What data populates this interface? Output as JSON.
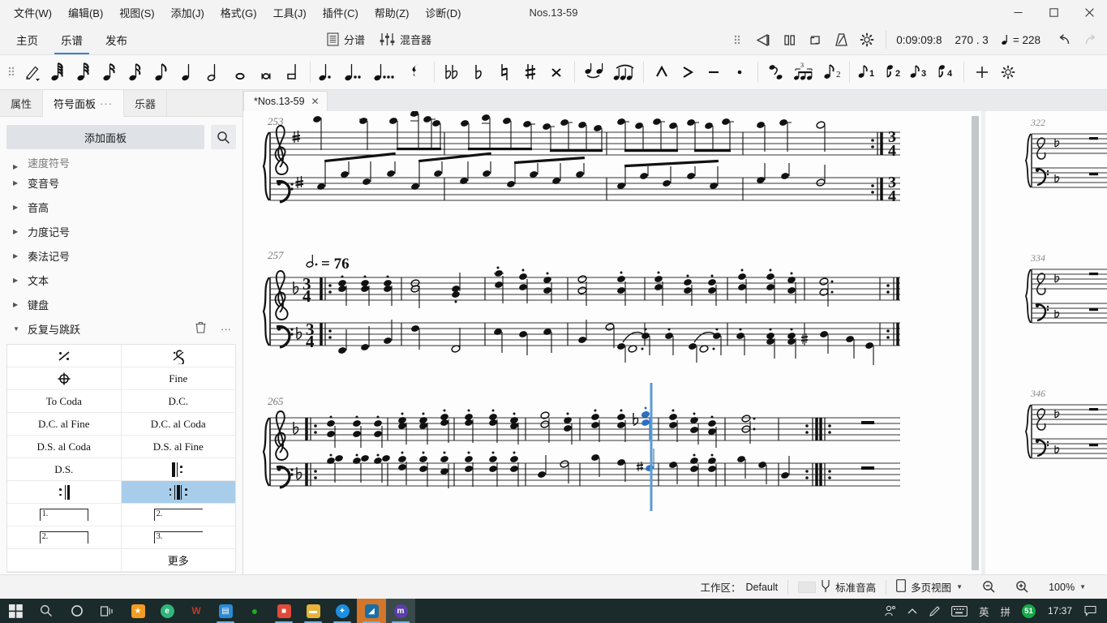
{
  "window": {
    "title": "Nos.13-59",
    "minimize": "–",
    "maximize": "☐",
    "close": "✕"
  },
  "menubar": [
    {
      "label": "文件(W)",
      "name": "menu-file"
    },
    {
      "label": "编辑(B)",
      "name": "menu-edit"
    },
    {
      "label": "视图(S)",
      "name": "menu-view"
    },
    {
      "label": "添加(J)",
      "name": "menu-add"
    },
    {
      "label": "格式(G)",
      "name": "menu-format"
    },
    {
      "label": "工具(J)",
      "name": "menu-tools"
    },
    {
      "label": "插件(C)",
      "name": "menu-plugins"
    },
    {
      "label": "帮助(Z)",
      "name": "menu-help"
    },
    {
      "label": "诊断(D)",
      "name": "menu-diagnostic"
    }
  ],
  "ribbon": {
    "tabs": [
      {
        "label": "主页",
        "active": false
      },
      {
        "label": "乐谱",
        "active": true
      },
      {
        "label": "发布",
        "active": false
      }
    ],
    "parts_label": "分谱",
    "mixer_label": "混音器",
    "timecode": "0:09:09:8",
    "position": "270 . 3",
    "tempo_value": "= 228",
    "tempo_note": "♩"
  },
  "notebar": {
    "durations": [
      "pencil",
      "128th",
      "64th",
      "32nd",
      "16th",
      "eighth",
      "quarter",
      "half",
      "whole",
      "breve",
      "longa"
    ],
    "dots": [
      "dotted",
      "double-dotted",
      "triple-dotted",
      "rest"
    ],
    "accidentals": [
      "double-flat",
      "flat",
      "natural",
      "sharp",
      "double-sharp"
    ],
    "ties": [
      "tie",
      "slur"
    ],
    "articulations": [
      "marcato",
      "accent",
      "tenuto",
      "staccato"
    ],
    "rhythm": [
      "flip-stem",
      "tuplet",
      "grace-note"
    ],
    "voices": [
      "1",
      "2",
      "3",
      "4"
    ],
    "plus": "+",
    "gear": "gear"
  },
  "leftpanel": {
    "tabs": [
      {
        "label": "属性",
        "name": "tab-properties",
        "active": false
      },
      {
        "label": "符号面板",
        "name": "tab-symbol-panel",
        "active": true,
        "dots": "···"
      },
      {
        "label": "乐器",
        "name": "tab-instruments",
        "active": false
      }
    ],
    "add_panel_label": "添加面板",
    "search_icon": "search-icon",
    "categories": [
      {
        "label": "速度符号",
        "expanded": false,
        "clipped": true
      },
      {
        "label": "变音号",
        "expanded": false
      },
      {
        "label": "音高",
        "expanded": false
      },
      {
        "label": "力度记号",
        "expanded": false
      },
      {
        "label": "奏法记号",
        "expanded": false
      },
      {
        "label": "文本",
        "expanded": false
      },
      {
        "label": "键盘",
        "expanded": false
      }
    ],
    "open_category": {
      "label": "反复与跳跃",
      "delete_icon": "trash-icon",
      "more_icon": "more-icon"
    },
    "symbols": [
      {
        "label": "⁓",
        "kind": "glyph",
        "name": "symbol-repeat-measure",
        "selected": false
      },
      {
        "label": "𝄌",
        "kind": "segno",
        "name": "symbol-segno",
        "selected": false
      },
      {
        "label": "⊕",
        "kind": "coda",
        "name": "symbol-coda",
        "selected": false
      },
      {
        "label": "Fine",
        "kind": "text",
        "name": "symbol-fine",
        "selected": false
      },
      {
        "label": "To Coda",
        "kind": "text",
        "name": "symbol-to-coda",
        "selected": false
      },
      {
        "label": "D.C.",
        "kind": "text",
        "name": "symbol-dc",
        "selected": false
      },
      {
        "label": "D.C. al Fine",
        "kind": "text",
        "name": "symbol-dc-al-fine",
        "selected": false
      },
      {
        "label": "D.C. al Coda",
        "kind": "text",
        "name": "symbol-dc-al-coda",
        "selected": false
      },
      {
        "label": "D.S. al Coda",
        "kind": "text",
        "name": "symbol-ds-al-coda",
        "selected": false
      },
      {
        "label": "D.S. al Fine",
        "kind": "text",
        "name": "symbol-ds-al-fine",
        "selected": false
      },
      {
        "label": "D.S.",
        "kind": "text",
        "name": "symbol-ds",
        "selected": false
      },
      {
        "label": "",
        "kind": "repeat-start",
        "name": "symbol-repeat-start",
        "selected": false
      },
      {
        "label": "",
        "kind": "repeat-end",
        "name": "symbol-repeat-end",
        "selected": false
      },
      {
        "label": "",
        "kind": "repeat-both",
        "name": "symbol-repeat-end-start",
        "selected": true
      },
      {
        "label": "1.",
        "kind": "volta",
        "name": "symbol-volta-1",
        "selected": false
      },
      {
        "label": "2.",
        "kind": "volta-open",
        "name": "symbol-volta-2-open",
        "selected": false
      },
      {
        "label": "2.",
        "kind": "volta",
        "name": "symbol-volta-2",
        "selected": false
      },
      {
        "label": "3.",
        "kind": "volta-open",
        "name": "symbol-volta-3-open",
        "selected": false
      },
      {
        "label": "",
        "kind": "empty",
        "name": "symbol-empty",
        "selected": false
      },
      {
        "label": "更多",
        "kind": "text-cn",
        "name": "symbol-more",
        "selected": false
      }
    ]
  },
  "score": {
    "doc_tab": "*Nos.13-59",
    "doc_tab_close": "✕",
    "systems": [
      {
        "measure_number": "253",
        "key": "1-sharp",
        "tempo": null
      },
      {
        "measure_number": "257",
        "key": "1-flat",
        "time": "3/4",
        "tempo": "= 76",
        "tempo_note": "♩."
      },
      {
        "measure_number": "265",
        "key": "1-flat",
        "tempo": null
      }
    ],
    "thumbnails": [
      {
        "measure_number": "322"
      },
      {
        "measure_number": "334"
      },
      {
        "measure_number": "346"
      }
    ]
  },
  "statusbar": {
    "workspace_label": "工作区：",
    "workspace_value": "Default",
    "pitch_label": "标准音高",
    "view_label": "多页视图",
    "zoom": "100%",
    "zoom_out": "zoom-out-icon",
    "zoom_in": "zoom-in-icon"
  },
  "taskbar": {
    "start": "start-icon",
    "search": "search-icon",
    "cortana": "cortana-icon",
    "taskview": "task-view-icon",
    "apps": [
      {
        "name": "app-star",
        "color": "#f39c22",
        "glyph": "★"
      },
      {
        "name": "app-edge",
        "color": "#2eb67d",
        "glyph": "e"
      },
      {
        "name": "app-wps",
        "color": "#c0392b",
        "glyph": "W"
      },
      {
        "name": "app-media",
        "color": "#2b8ad6",
        "glyph": "▤"
      },
      {
        "name": "app-wechat",
        "color": "#1aad19",
        "glyph": "●"
      },
      {
        "name": "app-recorder",
        "color": "#e04a3b",
        "glyph": "■"
      },
      {
        "name": "app-explorer",
        "color": "#e8b339",
        "glyph": "▬"
      },
      {
        "name": "app-blue",
        "color": "#1a8fe3",
        "glyph": "✦"
      },
      {
        "name": "app-orange-active",
        "color": "#1a6fa8",
        "glyph": "◢"
      },
      {
        "name": "app-musescore",
        "color": "#5b3fa8",
        "glyph": "m"
      }
    ],
    "tray": [
      "people-icon",
      "chevron-up-icon",
      "pen-icon",
      "keyboard-icon"
    ],
    "ime_lang": "英",
    "ime_mode": "拼",
    "badge": "51",
    "clock": "17:37",
    "notifications": "notification-icon"
  }
}
